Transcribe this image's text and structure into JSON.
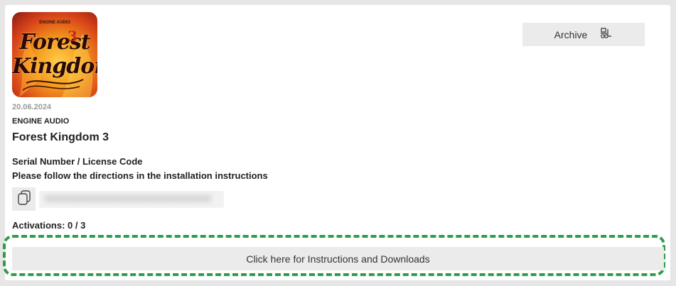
{
  "product": {
    "cover_brand": "ENGINE AUDIO",
    "cover_title": "Forest Kingdom",
    "cover_number": "3",
    "date": "20.06.2024",
    "vendor": "ENGINE AUDIO",
    "name": "Forest Kingdom 3"
  },
  "archive": {
    "label": "Archive",
    "icon": "archive-download-icon"
  },
  "license": {
    "serial_label": "Serial Number / License Code",
    "directions": "Please follow the directions in the installation instructions",
    "copy_icon": "copy-icon",
    "activations": "Activations: 0 / 3"
  },
  "instructions_button": {
    "label": "Click here for Instructions and Downloads"
  },
  "colors": {
    "highlight": "#2e9e44",
    "button_bg": "#ebebeb",
    "page_bg": "#e6e6e6"
  }
}
